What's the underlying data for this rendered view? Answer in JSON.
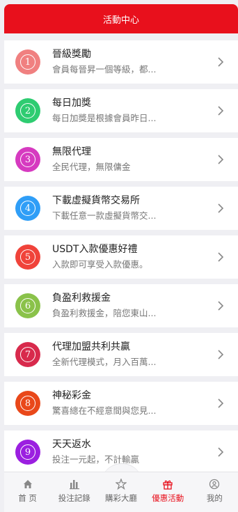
{
  "header": {
    "title": "活動中心"
  },
  "items": [
    {
      "num": "1",
      "color": "#f08080",
      "title": "晉級獎勵",
      "desc": "會員每晉昇一個等級，都..."
    },
    {
      "num": "2",
      "color": "#2ecc71",
      "title": "每日加獎",
      "desc": "每日加獎是根據會員昨日..."
    },
    {
      "num": "3",
      "color": "#d63ac0",
      "title": "無限代理",
      "desc": "全民代理，無限傭金"
    },
    {
      "num": "4",
      "color": "#2f9ef7",
      "title": "下載虛擬貨幣交易所",
      "desc": "下載任意一款虛擬貨幣交..."
    },
    {
      "num": "5",
      "color": "#f0433a",
      "title": "USDT入款優惠好禮",
      "desc": "入款即可享受入款優惠。"
    },
    {
      "num": "6",
      "color": "#8ac24a",
      "title": "負盈利救援金",
      "desc": "負盈利救援金，陪您東山..."
    },
    {
      "num": "7",
      "color": "#d82a4c",
      "title": "代理加盟共利共贏",
      "desc": "全新代理模式，月入百萬..."
    },
    {
      "num": "8",
      "color": "#e9481a",
      "title": "神秘彩金",
      "desc": "驚喜總在不經意間與您見..."
    },
    {
      "num": "9",
      "color": "#9b1fe0",
      "title": "天天返水",
      "desc": "投注一元起，不計輸贏"
    }
  ],
  "tabbar": [
    {
      "label": "首 页",
      "icon": "home-icon",
      "active": false
    },
    {
      "label": "投注記錄",
      "icon": "bar-chart-icon",
      "active": false
    },
    {
      "label": "購彩大廳",
      "icon": "star-icon",
      "active": false
    },
    {
      "label": "優惠活動",
      "icon": "gift-icon",
      "active": true
    },
    {
      "label": "我的",
      "icon": "user-icon",
      "active": false
    }
  ],
  "colors": {
    "accent": "#e8101c"
  }
}
